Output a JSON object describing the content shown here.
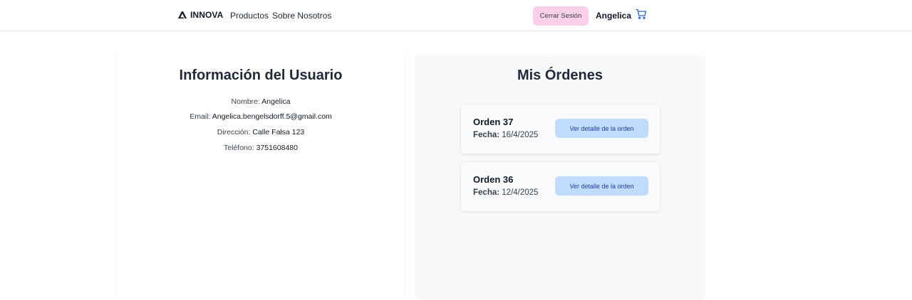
{
  "header": {
    "brand": "INNOVA",
    "nav": {
      "productos": "Productos",
      "sobre_nosotros": "Sobre Nosotros"
    },
    "logout_label": "Cerrar Sesión",
    "user_name": "Angelica",
    "cart_icon": "cart-icon"
  },
  "user_info": {
    "title": "Información del Usuario",
    "nombre_label": "Nombre:",
    "nombre": "Angelica",
    "email_label": "Email:",
    "email": "Angelica.bengelsdorff.5@gmail.com",
    "direccion_label": "Dirección:",
    "direccion": "Calle Falsa 123",
    "telefono_label": "Teléfono:",
    "telefono": "3751608480"
  },
  "orders": {
    "title": "Mis Órdenes",
    "fecha_label": "Fecha:",
    "detail_label": "Ver detalle de la orden",
    "items": [
      {
        "name": "Orden 37",
        "date": "16/4/2025"
      },
      {
        "name": "Orden 36",
        "date": "12/4/2025"
      }
    ]
  },
  "colors": {
    "logout_bg": "#fbcfe8",
    "detail_bg": "#bfdbfe",
    "detail_text": "#1e40af",
    "cart_icon": "#2563eb",
    "orders_panel_bg": "#f8f9fb"
  }
}
